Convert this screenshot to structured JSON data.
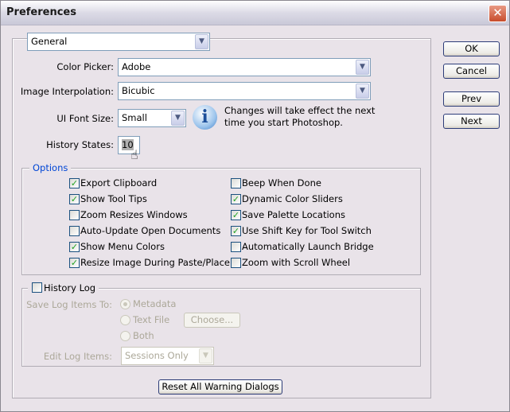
{
  "window": {
    "title": "Preferences",
    "close_icon": "close-icon"
  },
  "section_select": {
    "value": "General"
  },
  "fields": {
    "color_picker": {
      "label": "Color Picker:",
      "value": "Adobe"
    },
    "image_interpolation": {
      "label": "Image Interpolation:",
      "value": "Bicubic"
    },
    "ui_font_size": {
      "label": "UI Font Size:",
      "value": "Small"
    },
    "history_states": {
      "label": "History States:",
      "value": "10"
    }
  },
  "info": {
    "icon": "info-icon",
    "line1": "Changes will take effect the next",
    "line2": "time you start Photoshop."
  },
  "options": {
    "legend": "Options",
    "legend_color": "#0046d5",
    "items": [
      {
        "label": "Export Clipboard",
        "checked": true
      },
      {
        "label": "Show Tool Tips",
        "checked": true
      },
      {
        "label": "Zoom Resizes Windows",
        "checked": false
      },
      {
        "label": "Auto-Update Open Documents",
        "checked": false
      },
      {
        "label": "Show Menu Colors",
        "checked": true
      },
      {
        "label": "Resize Image During Paste/Place",
        "checked": true
      },
      {
        "label": "Beep When Done",
        "checked": false
      },
      {
        "label": "Dynamic Color Sliders",
        "checked": true
      },
      {
        "label": "Save Palette Locations",
        "checked": true
      },
      {
        "label": "Use Shift Key for Tool Switch",
        "checked": true
      },
      {
        "label": "Automatically Launch Bridge",
        "checked": false
      },
      {
        "label": "Zoom with Scroll Wheel",
        "checked": false
      }
    ]
  },
  "history_log": {
    "label": "History Log",
    "checked": false,
    "save_label": "Save Log Items To:",
    "radios": [
      {
        "label": "Metadata",
        "selected": true
      },
      {
        "label": "Text File",
        "selected": false
      },
      {
        "label": "Both",
        "selected": false
      }
    ],
    "choose_button": "Choose...",
    "edit_label": "Edit Log Items:",
    "edit_value": "Sessions Only"
  },
  "buttons": {
    "ok": "OK",
    "cancel": "Cancel",
    "prev": "Prev",
    "next": "Next",
    "reset": "Reset All Warning Dialogs"
  }
}
